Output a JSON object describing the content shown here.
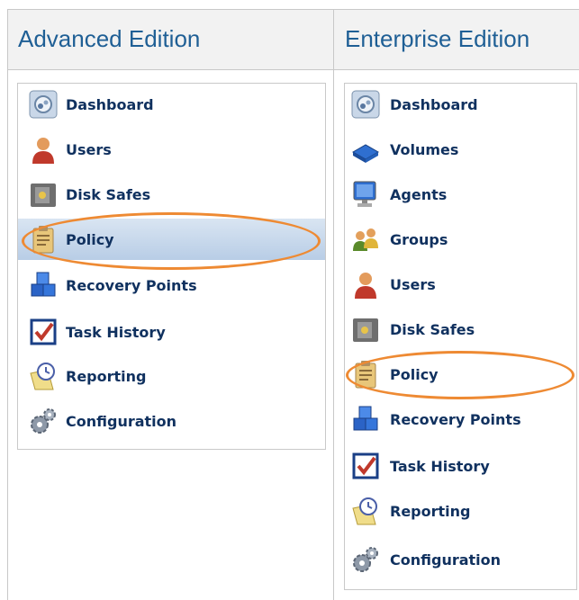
{
  "columns": [
    {
      "header": "Advanced Edition",
      "items": [
        {
          "label": "Dashboard",
          "icon": "dashboard-icon"
        },
        {
          "label": "Users",
          "icon": "user-icon"
        },
        {
          "label": "Disk Safes",
          "icon": "safe-icon"
        },
        {
          "label": "Policy",
          "icon": "policy-clipboard-icon",
          "selected": true
        },
        {
          "label": "Recovery Points",
          "icon": "recovery-cubes-icon"
        },
        {
          "label": "Task History",
          "icon": "task-checkbox-icon"
        },
        {
          "label": "Reporting",
          "icon": "reporting-clock-icon"
        },
        {
          "label": "Configuration",
          "icon": "gears-icon"
        }
      ]
    },
    {
      "header": "Enterprise Edition",
      "items": [
        {
          "label": "Dashboard",
          "icon": "dashboard-icon"
        },
        {
          "label": "Volumes",
          "icon": "volume-book-icon"
        },
        {
          "label": "Agents",
          "icon": "computer-monitor-icon"
        },
        {
          "label": "Groups",
          "icon": "group-users-icon"
        },
        {
          "label": "Users",
          "icon": "user-icon"
        },
        {
          "label": "Disk Safes",
          "icon": "safe-icon"
        },
        {
          "label": "Policy",
          "icon": "policy-clipboard-icon"
        },
        {
          "label": "Recovery Points",
          "icon": "recovery-cubes-icon"
        },
        {
          "label": "Task History",
          "icon": "task-checkbox-icon"
        },
        {
          "label": "Reporting",
          "icon": "reporting-clock-icon"
        },
        {
          "label": "Configuration",
          "icon": "gears-icon"
        }
      ]
    }
  ]
}
